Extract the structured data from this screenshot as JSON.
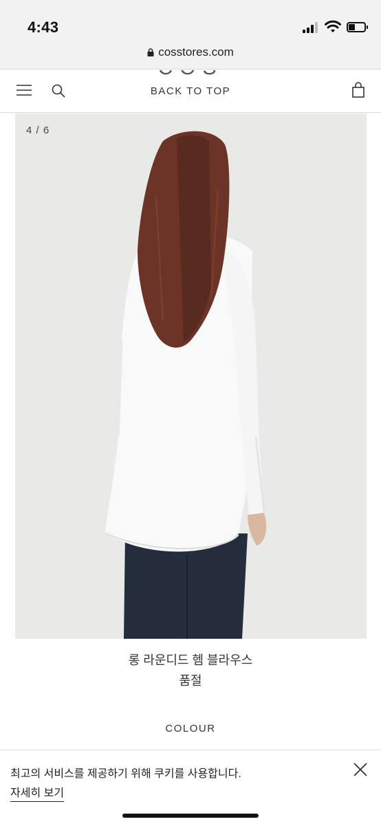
{
  "status_bar": {
    "time": "4:43"
  },
  "browser": {
    "url": "cosstores.com"
  },
  "header": {
    "logo": "COS",
    "back_to_top": "BACK TO TOP"
  },
  "gallery": {
    "counter": "4 / 6"
  },
  "product": {
    "name": "롱 라운디드 헴 블라우스",
    "status": "품절",
    "colour_label": "COLOUR"
  },
  "cookie": {
    "message": "최고의 서비스를 제공하기 위해 쿠키를 사용합니다.",
    "link": "자세히 보기"
  },
  "icons": [
    "lock-icon",
    "menu-icon",
    "search-icon",
    "bag-icon",
    "close-icon"
  ],
  "colors": {
    "background": "#ffffff",
    "image_bg": "#e9e9e8",
    "text": "#222222"
  }
}
